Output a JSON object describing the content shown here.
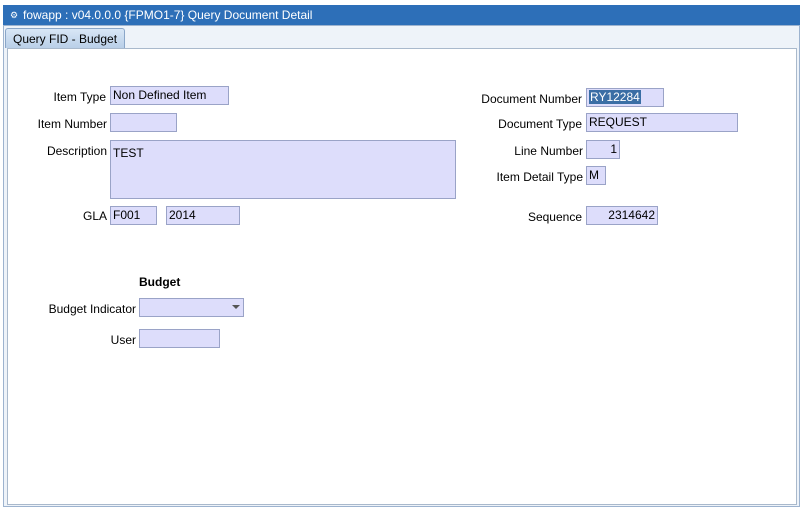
{
  "window": {
    "title": "fowapp : v04.0.0.0  {FPMO1-7} Query Document Detail",
    "icon": "app-icon"
  },
  "tabs": [
    {
      "label": "Query FID - Budget",
      "active": true
    }
  ],
  "item": {
    "item_type_label": "Item Type",
    "item_type_value": "Non Defined Item",
    "item_number_label": "Item Number",
    "item_number_value": "",
    "description_label": "Description",
    "description_value": "TEST",
    "gla_label": "GLA",
    "gla_value_1": "F001",
    "gla_value_2": "2014"
  },
  "document": {
    "document_number_label": "Document Number",
    "document_number_value": "RY12284",
    "document_type_label": "Document Type",
    "document_type_value": "REQUEST",
    "line_number_label": "Line Number",
    "line_number_value": "1",
    "item_detail_type_label": "Item Detail Type",
    "item_detail_type_value": "M",
    "sequence_label": "Sequence",
    "sequence_value": "2314642"
  },
  "budget": {
    "heading": "Budget",
    "indicator_label": "Budget Indicator",
    "indicator_value": "",
    "user_label": "User",
    "user_value": ""
  },
  "colors": {
    "titlebar": "#2d6fb8",
    "field_bg": "#ddddfb",
    "selection": "#3a6ea5"
  }
}
